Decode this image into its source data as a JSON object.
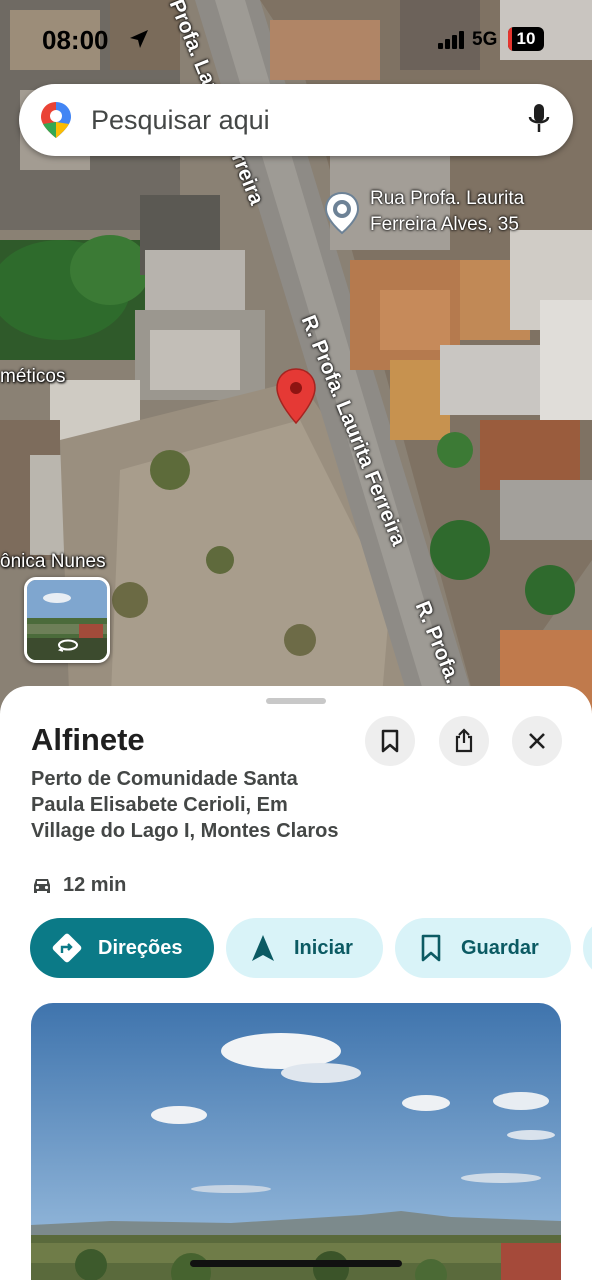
{
  "status_bar": {
    "time": "08:00",
    "network": "5G",
    "battery": "10",
    "battery_color": "#e5352e"
  },
  "search": {
    "placeholder": "Pesquisar aqui",
    "logo_icon": "google-maps-pin-icon",
    "mic_icon": "mic-icon"
  },
  "map": {
    "street_labels": [
      "Profa. Laurita Ferreira",
      "R. Profa. Laurita Ferreira",
      "R. Profa."
    ],
    "poi": {
      "line1": "Rua Profa. Laurita",
      "line2": "Ferreira Alves, 35"
    },
    "edge_labels": [
      "méticos",
      "ônica Nunes"
    ]
  },
  "place": {
    "title": "Alfinete",
    "address": "Perto de Comunidade Santa Paula Elisabete Cerioli, Em Village do Lago I, Montes Claros",
    "drive_time": "12 min"
  },
  "actions": [
    {
      "label": "Direções",
      "icon": "directions-icon"
    },
    {
      "label": "Iniciar",
      "icon": "navigation-arrow-icon"
    },
    {
      "label": "Guardar",
      "icon": "bookmark-icon"
    }
  ],
  "colors": {
    "primary": "#0b7a87",
    "secondary_chip": "#d9f3f8",
    "pin_red": "#e53935"
  }
}
